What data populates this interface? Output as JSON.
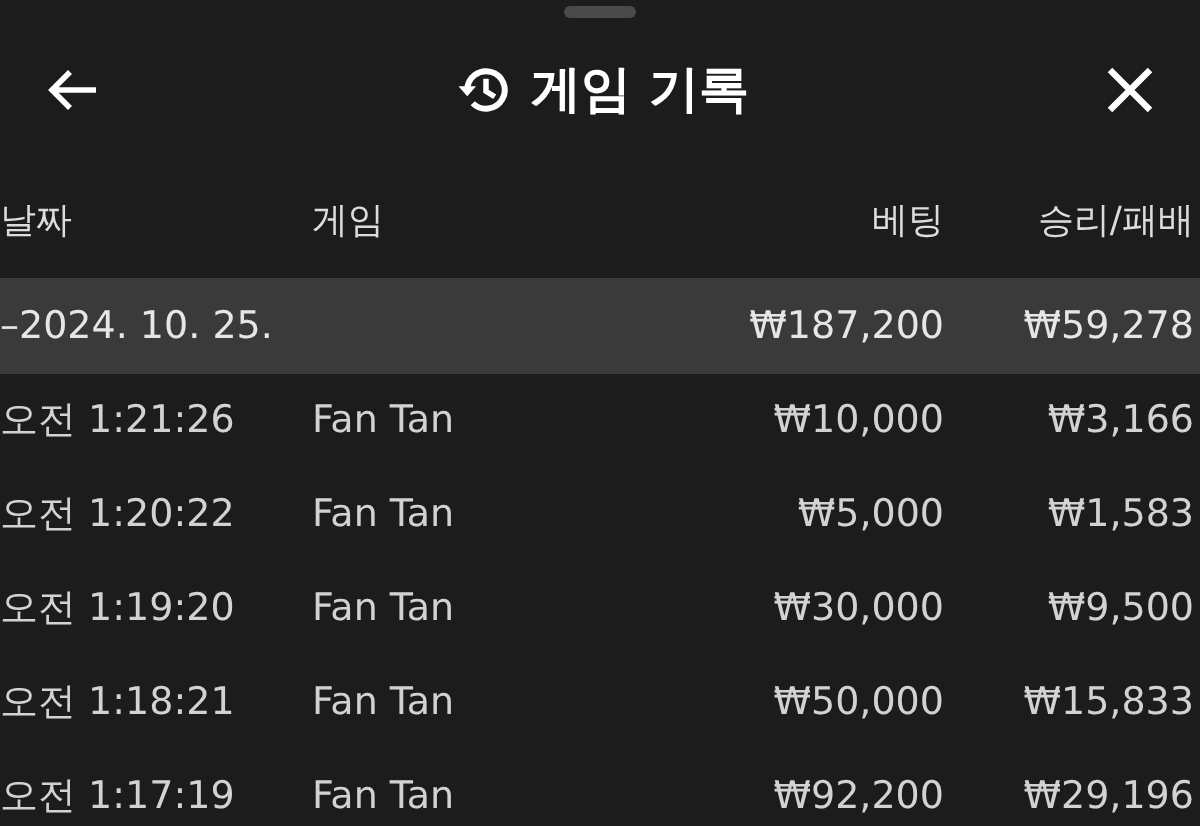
{
  "header": {
    "title": "게임 기록"
  },
  "table": {
    "columns": [
      "날짜",
      "게임",
      "베팅",
      "승리/패배"
    ],
    "rows": [
      {
        "kind": "group",
        "date": "–2024. 10. 25.",
        "bet": "₩187,200",
        "result": "₩59,278"
      },
      {
        "kind": "entry",
        "date": "오전 1:21:26",
        "game": "Fan Tan",
        "bet": "₩10,000",
        "result": "₩3,166"
      },
      {
        "kind": "entry",
        "date": "오전 1:20:22",
        "game": "Fan Tan",
        "bet": "₩5,000",
        "result": "₩1,583"
      },
      {
        "kind": "entry",
        "date": "오전 1:19:20",
        "game": "Fan Tan",
        "bet": "₩30,000",
        "result": "₩9,500"
      },
      {
        "kind": "entry",
        "date": "오전 1:18:21",
        "game": "Fan Tan",
        "bet": "₩50,000",
        "result": "₩15,833"
      },
      {
        "kind": "entry",
        "date": "오전 1:17:19",
        "game": "Fan Tan",
        "bet": "₩92,200",
        "result": "₩29,196"
      }
    ]
  }
}
